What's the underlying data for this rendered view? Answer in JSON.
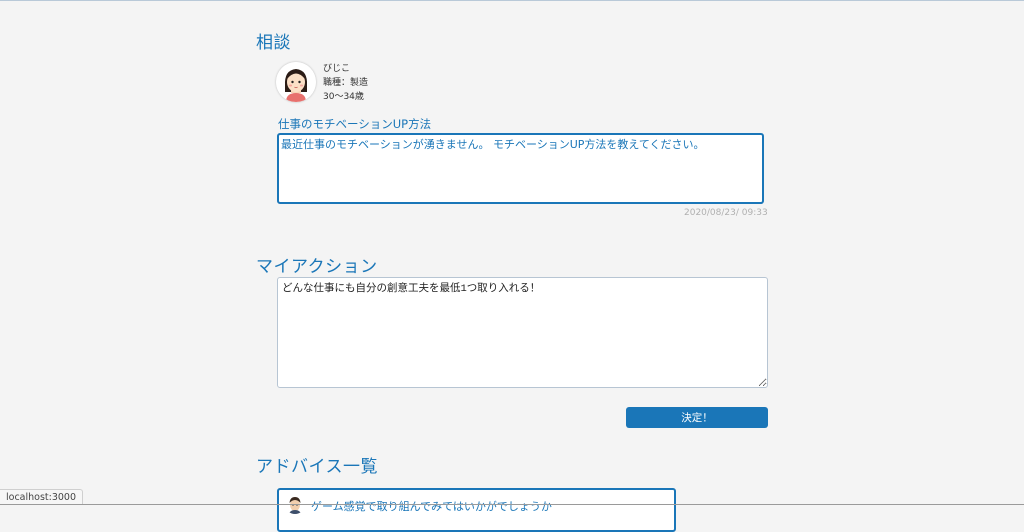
{
  "consultation": {
    "heading": "相談",
    "user": {
      "name": "びじこ",
      "job": "職種：製造",
      "age": "30〜34歳",
      "avatar_icon": "girl-avatar-icon"
    },
    "title": "仕事のモチベーションUP方法",
    "body": "最近仕事のモチベーションが湧きません。 モチベーションUP方法を教えてください。",
    "timestamp": "2020/08/23/ 09:33"
  },
  "my_action": {
    "heading": "マイアクション",
    "value": "どんな仕事にも自分の創意工夫を最低1つ取り入れる！",
    "submit_label": "決定！"
  },
  "advice": {
    "heading": "アドバイス一覧",
    "items": [
      {
        "text": "ゲーム感覚で取り組んでみてはいかがでしょうか",
        "avatar_icon": "man-avatar-icon"
      }
    ]
  },
  "status_bar": {
    "url": "localhost:3000"
  },
  "colors": {
    "accent": "#1a76b8",
    "background": "#f4f4f4"
  }
}
